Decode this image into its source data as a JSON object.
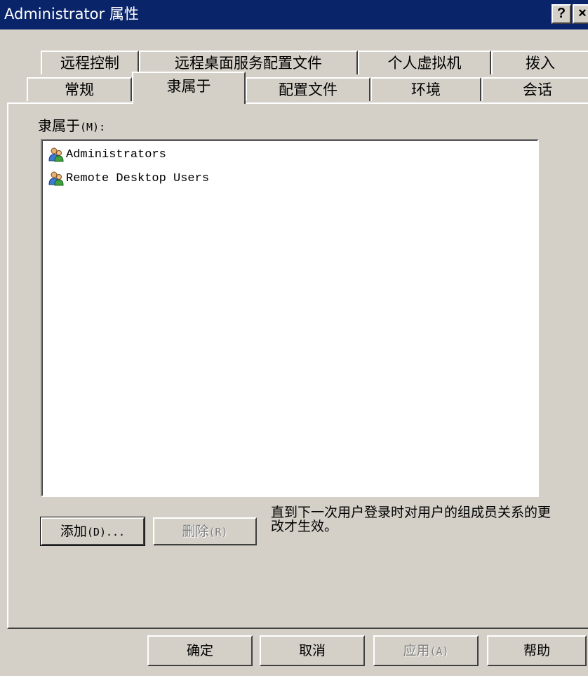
{
  "window": {
    "title": "Administrator 属性",
    "help_button": "?",
    "close_button": "×"
  },
  "tabs": {
    "row_back": [
      "远程控制",
      "远程桌面服务配置文件",
      "个人虚拟机",
      "拨入"
    ],
    "row_front": [
      "常规",
      "隶属于",
      "配置文件",
      "环境",
      "会话"
    ],
    "selected": "隶属于"
  },
  "member_of": {
    "label": "隶属于",
    "accelerator": "(M):",
    "items": [
      {
        "name": "Administrators",
        "icon": "group-icon"
      },
      {
        "name": "Remote Desktop Users",
        "icon": "group-icon"
      }
    ]
  },
  "buttons": {
    "add": {
      "label": "添加",
      "accel": "(D)..."
    },
    "remove": {
      "label": "删除",
      "accel": "(R)"
    }
  },
  "note": "直到下一次用户登录时对用户的组成员关系的更改才生效。",
  "footer": {
    "ok": "确定",
    "cancel": "取消",
    "apply": {
      "label": "应用",
      "accel": "(A)"
    },
    "help": "帮助"
  }
}
